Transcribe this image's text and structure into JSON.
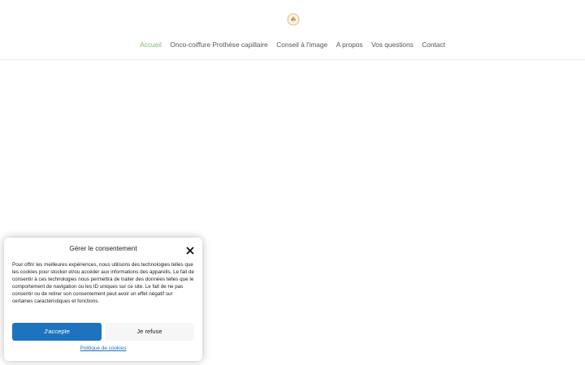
{
  "header": {
    "logo_icon": "circular-flower-logo-icon",
    "nav": [
      {
        "label": "Accueil",
        "active": true
      },
      {
        "label": "Onco-coiffure Prothèse capillaire",
        "active": false
      },
      {
        "label": "Conseil à l'image",
        "active": false
      },
      {
        "label": "A propos",
        "active": false
      },
      {
        "label": "Vos questions",
        "active": false
      },
      {
        "label": "Contact",
        "active": false
      }
    ]
  },
  "consent": {
    "title": "Gérer le consentement",
    "close_icon": "close-icon",
    "text": "Pour offrir les meilleures expériences, nous utilisons des technologies telles que les cookies pour stocker et/ou accéder aux informations des appareils. Le fait de consentir à ces technologies nous permettra de traiter des données telles que le comportement de navigation ou les ID uniques sur ce site. Le fait de ne pas consentir ou de retirer son consentement peut avoir un effet négatif sur certaines caractéristiques et fonctions.",
    "accept_label": "J'accepte",
    "refuse_label": "Je refuse",
    "cookie_policy_label": "Politique de cookies"
  },
  "colors": {
    "accent": "#1e73be",
    "nav_active": "#7fbf6f",
    "nav_text": "#555555"
  }
}
